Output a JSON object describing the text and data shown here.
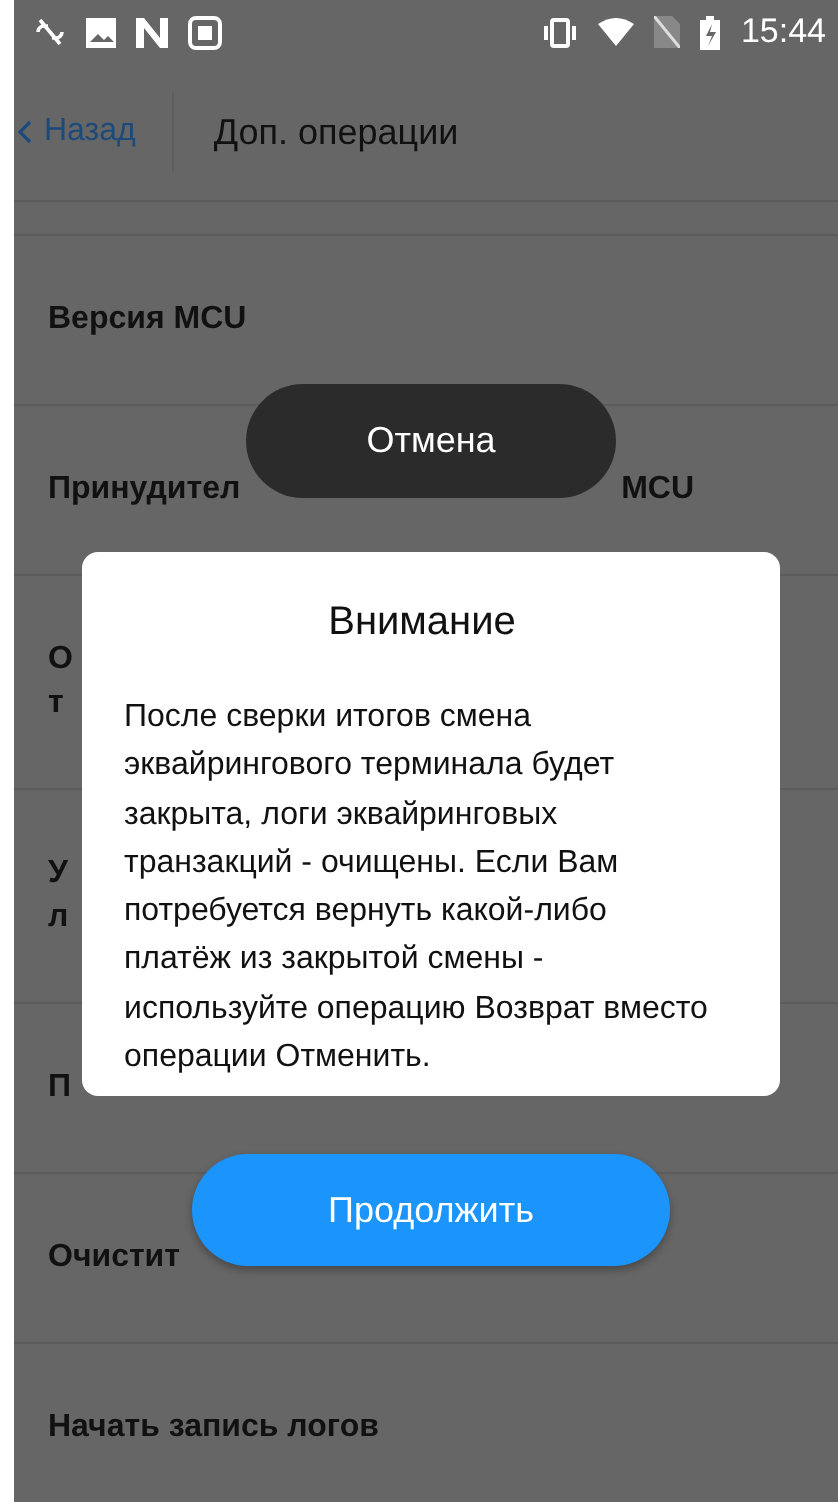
{
  "status_bar": {
    "time": "15:44"
  },
  "header": {
    "back": "Назад",
    "title": "Доп. операции"
  },
  "operations": [
    {
      "lines": [
        "Версия MCU"
      ]
    },
    {
      "lines": [
        "Принудител"
      ],
      "trailing": "MCU"
    },
    {
      "lines": [
        "О",
        "т"
      ]
    },
    {
      "lines": [
        "У",
        "л"
      ]
    },
    {
      "lines": [
        "П"
      ]
    },
    {
      "lines": [
        "Очистит"
      ]
    },
    {
      "lines": [
        "Начать запись логов"
      ]
    }
  ],
  "toast": {
    "text": "Отмена"
  },
  "dialog": {
    "title": "Внимание",
    "message": "После сверки итогов смена эквайрингового терминала будет закрыта, логи эквайринговых транзакций - очищены. Если Вам потребуется вернуть какой-либо платёж из закрытой смены - используйте операцию Возврат вместо операции Отменить."
  },
  "continue_button": {
    "label": "Продолжить"
  }
}
